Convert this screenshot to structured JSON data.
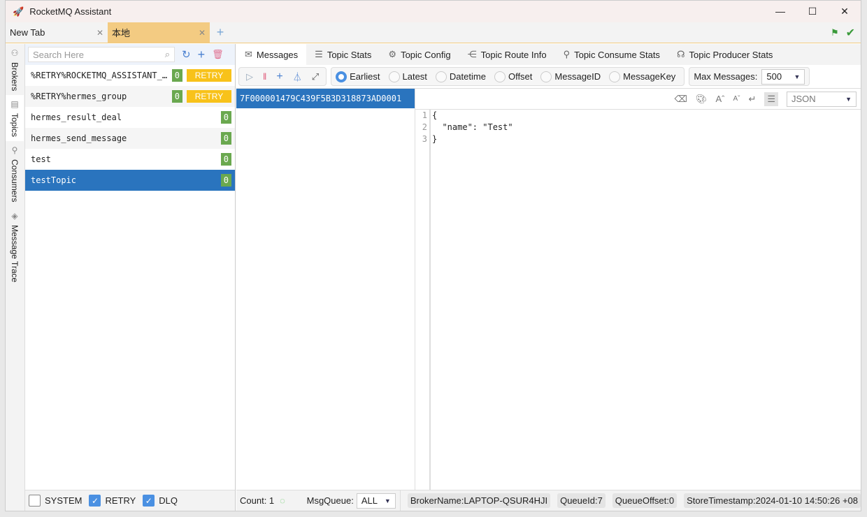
{
  "app": {
    "title": "RocketMQ Assistant"
  },
  "tabs": [
    {
      "label": "New Tab"
    },
    {
      "label": "本地"
    }
  ],
  "side": {
    "items": [
      {
        "label": "Brokers"
      },
      {
        "label": "Topics"
      },
      {
        "label": "Consumers"
      },
      {
        "label": "Message Trace"
      }
    ]
  },
  "topics": {
    "search_placeholder": "Search Here",
    "items": [
      {
        "name": "%RETRY%ROCKETMQ_ASSISTANT_…",
        "count": "0",
        "tag": "RETRY"
      },
      {
        "name": "%RETRY%hermes_group",
        "count": "0",
        "tag": "RETRY"
      },
      {
        "name": "hermes_result_deal",
        "count": "0"
      },
      {
        "name": "hermes_send_message",
        "count": "0"
      },
      {
        "name": "test",
        "count": "0"
      },
      {
        "name": "testTopic",
        "count": "0",
        "selected": true
      }
    ],
    "filters": [
      {
        "label": "SYSTEM",
        "checked": false
      },
      {
        "label": "RETRY",
        "checked": true
      },
      {
        "label": "DLQ",
        "checked": true
      }
    ]
  },
  "main_tabs": [
    {
      "label": "Messages"
    },
    {
      "label": "Topic Stats"
    },
    {
      "label": "Topic Config"
    },
    {
      "label": "Topic Route Info"
    },
    {
      "label": "Topic Consume Stats"
    },
    {
      "label": "Topic Producer Stats"
    }
  ],
  "positions": [
    {
      "label": "Earliest",
      "selected": true
    },
    {
      "label": "Latest"
    },
    {
      "label": "Datetime"
    },
    {
      "label": "Offset"
    },
    {
      "label": "MessageID"
    },
    {
      "label": "MessageKey"
    }
  ],
  "max_messages": {
    "label": "Max Messages:",
    "value": "500"
  },
  "messages": [
    "7F000001479C439F5B3D318873AD0001"
  ],
  "viewer": {
    "format": "JSON",
    "line_numbers": [
      "1",
      "2",
      "3"
    ],
    "lines": [
      "{",
      "  \"name\": \"Test\"",
      "}"
    ]
  },
  "footer": {
    "count": "Count: 1",
    "msgqueue_label": "MsgQueue:",
    "msgqueue_value": "ALL",
    "broker": "BrokerName:LAPTOP-QSUR4HJI",
    "queue_id": "QueueId:7",
    "queue_offset": "QueueOffset:0",
    "store_ts": "StoreTimestamp:2024-01-10 14:50:26 +08"
  },
  "colors": {
    "accent": "#2a74be",
    "active_tab": "#f3cb82",
    "retry": "#f8c21a",
    "count_badge": "#6aa84f"
  }
}
